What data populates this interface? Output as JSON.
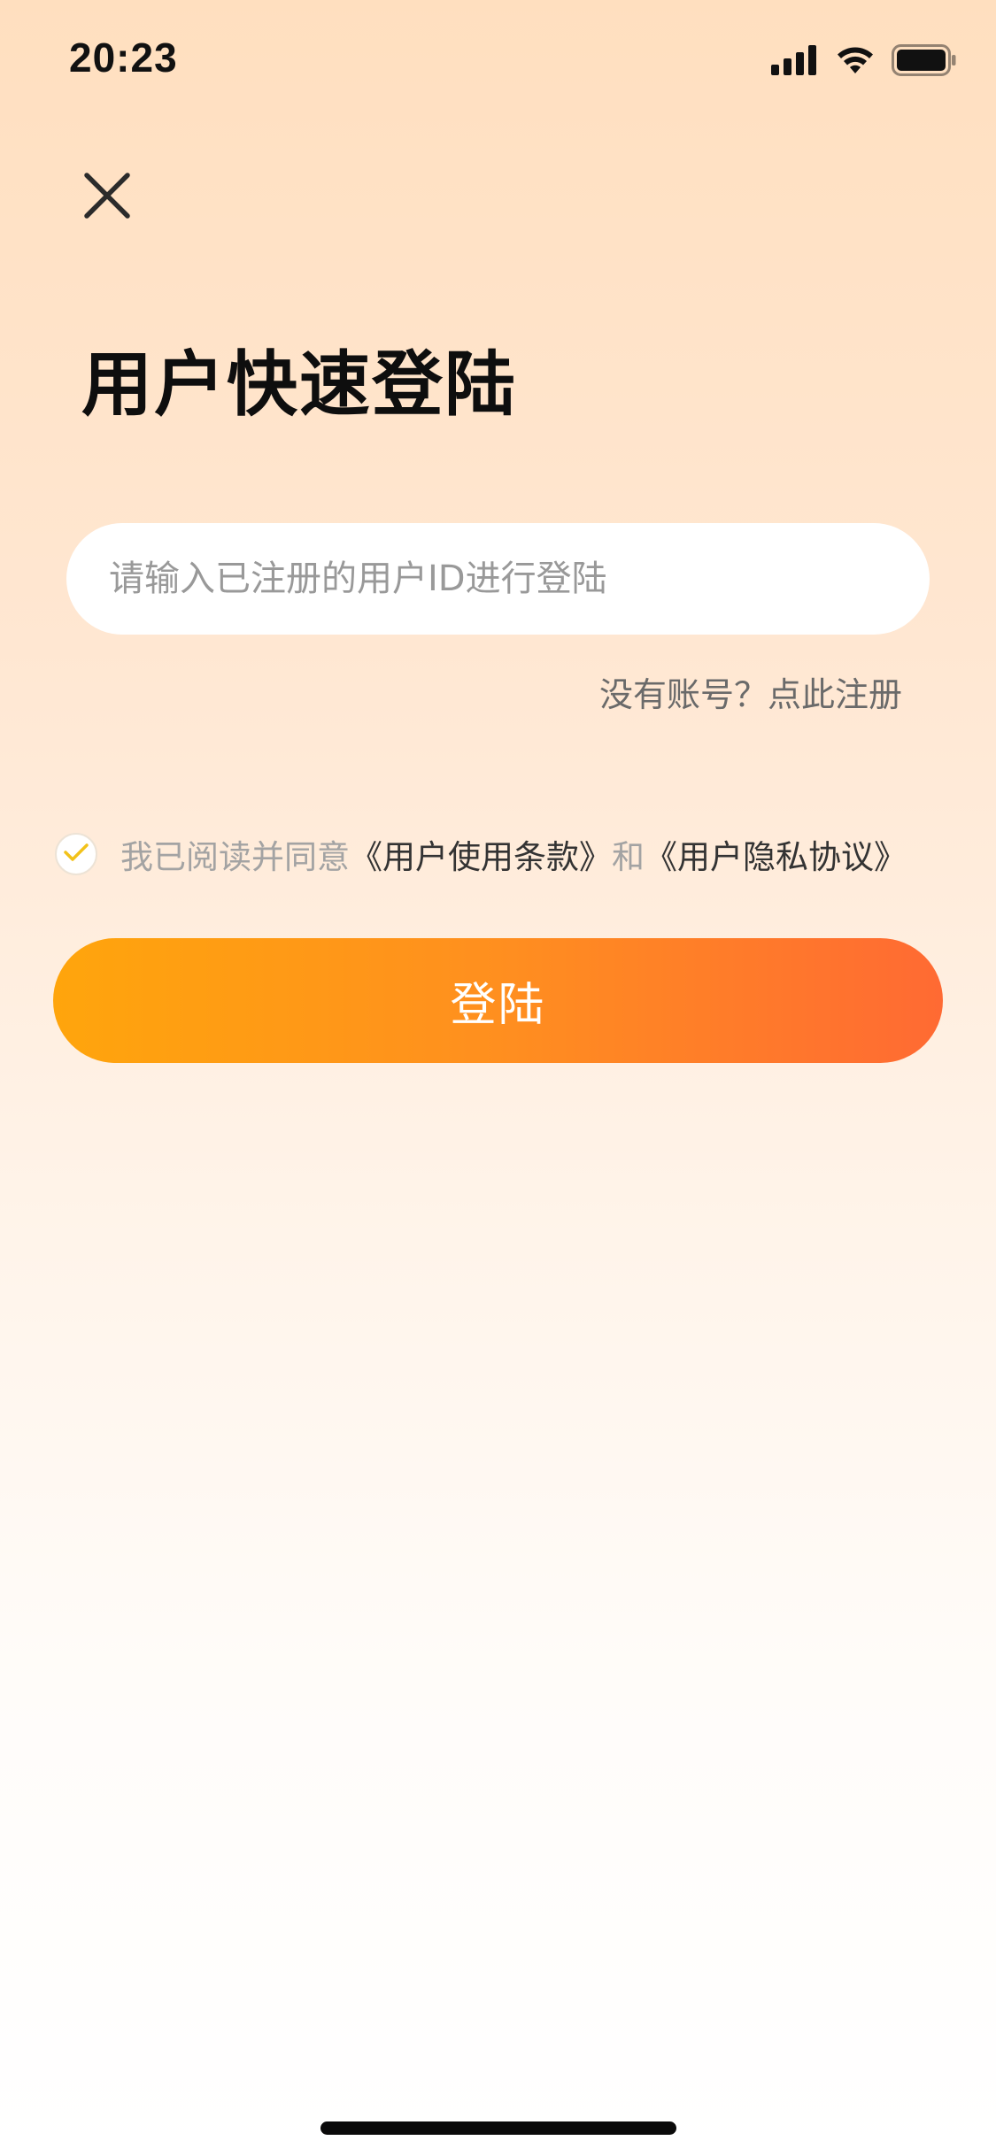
{
  "status_bar": {
    "time": "20:23",
    "icons": [
      "cellular-signal-icon",
      "wifi-icon",
      "battery-icon"
    ]
  },
  "header": {
    "close_icon": "close-icon"
  },
  "main": {
    "title": "用户快速登陆",
    "id_input": {
      "value": "",
      "placeholder": "请输入已注册的用户ID进行登陆"
    },
    "register_link": "没有账号？点此注册",
    "agreement": {
      "checked": true,
      "prefix": "我已阅读并同意",
      "terms_link": "《用户使用条款》",
      "conjunction": "和",
      "privacy_link": "《用户隐私协议》"
    },
    "login_button": "登陆"
  },
  "colors": {
    "accent_start": "#FFA50C",
    "accent_end": "#FF6A33",
    "check_mark": "#F2C21A",
    "background_top": "#FFDFBF",
    "background_bottom": "#FFFFFF"
  }
}
